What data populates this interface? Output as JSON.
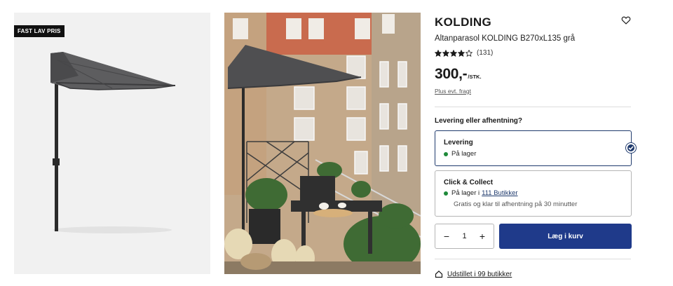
{
  "badge": "FAST LAV PRIS",
  "product": {
    "title": "KOLDING",
    "subtitle": "Altanparasol KOLDING B270xL135 grå",
    "rating": 4,
    "rating_count": "(131)",
    "price": "300,-",
    "unit": "/STK.",
    "freight_link": "Plus evt. fragt"
  },
  "delivery": {
    "question": "Levering eller afhentning?",
    "option1": {
      "title": "Levering",
      "status": "På lager",
      "selected": true
    },
    "option2": {
      "title": "Click & Collect",
      "status_prefix": "På lager i",
      "stores_link": "111 Butikker",
      "note": "Gratis og klar til afhentning på 30 minutter"
    }
  },
  "cart": {
    "minus": "−",
    "quantity": "1",
    "plus": "+",
    "add_label": "Læg i kurv"
  },
  "stores_display": "Udstillet i 99 butikker",
  "icons": {
    "wishlist": "heart-icon",
    "check": "check-icon",
    "store": "house-icon",
    "status": "green-dot-icon"
  },
  "colors": {
    "accent": "#1f3a8a",
    "border_selected": "#1f3a6d",
    "status_green": "#1f8a3a"
  }
}
